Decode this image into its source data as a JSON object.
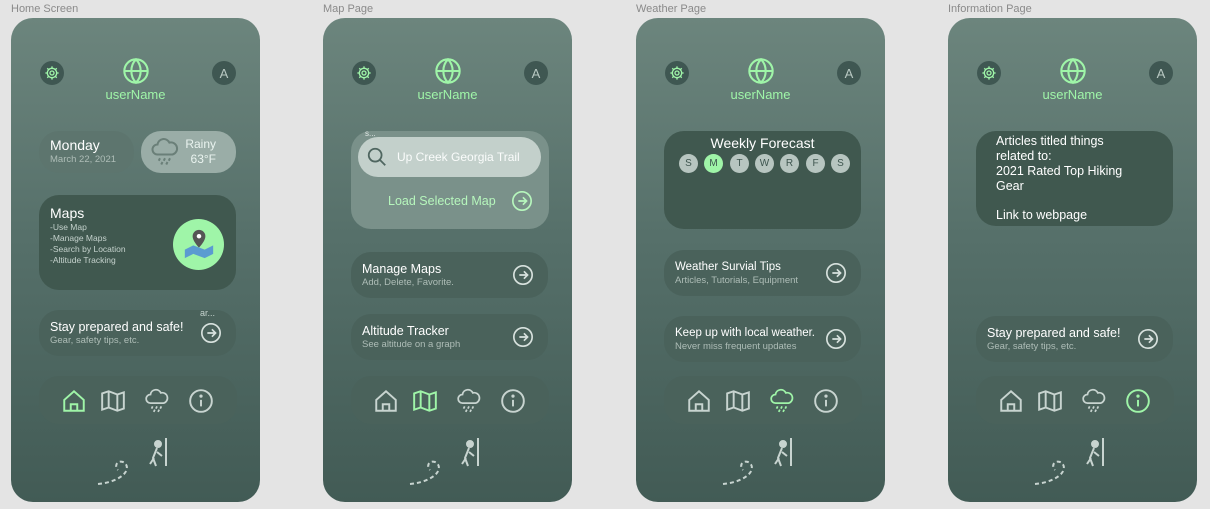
{
  "frames": [
    {
      "label": "Home Screen"
    },
    {
      "label": "Map Page"
    },
    {
      "label": "Weather Page"
    },
    {
      "label": "Information Page"
    }
  ],
  "header": {
    "username": "userName",
    "avatar_letter": "A"
  },
  "home": {
    "date_day": "Monday",
    "date_full": "March 22, 2021",
    "weather_condition": "Rainy",
    "weather_temp": "63°F",
    "maps_title": "Maps",
    "maps_items": [
      "-Use Map",
      "-Manage Maps",
      "-Search by Location",
      "-Altitude Tracking"
    ],
    "prepared_overlay": "ar...",
    "prepared_title": "Stay prepared and safe!",
    "prepared_sub": "Gear, safety tips, etc."
  },
  "map": {
    "search_label": "s...",
    "search_value": "Up Creek Georgia Trail",
    "load_label": "Load Selected Map",
    "manage_title": "Manage Maps",
    "manage_sub": "Add, Delete, Favorite.",
    "altitude_title": "Altitude Tracker",
    "altitude_sub": "See altitude on a graph"
  },
  "weather": {
    "forecast_title": "Weekly Forecast",
    "days": [
      "S",
      "M",
      "T",
      "W",
      "R",
      "F",
      "S"
    ],
    "selected_day": 1,
    "tips_title": "Weather Survial Tips",
    "tips_sub": "Articles, Tutorials, Equipment",
    "local_title": "Keep up with  local weather.",
    "local_sub": "Never miss frequent updates"
  },
  "info": {
    "article_line1": "Articles titled things",
    "article_line2": "related to:",
    "article_line3": "2021 Rated Top Hiking",
    "article_line4": "Gear",
    "article_link": "Link to webpage",
    "prepared_title": "Stay prepared and safe!",
    "prepared_sub": "Gear, safety tips, etc."
  },
  "nav": {
    "active_by_page": [
      "home",
      "map",
      "weather",
      "info"
    ]
  },
  "icons": [
    "gear-icon",
    "globe-icon",
    "cloud-rain-icon",
    "map-pin-icon",
    "search-icon",
    "arrow-right-circle-icon",
    "home-icon",
    "map-icon",
    "info-icon",
    "hiker-icon"
  ],
  "colors": {
    "accent": "#9ff5a8",
    "card": "#40584f",
    "card_light": "#7e958e",
    "text_muted": "#aebdb7",
    "background": "#e4e4e4"
  }
}
